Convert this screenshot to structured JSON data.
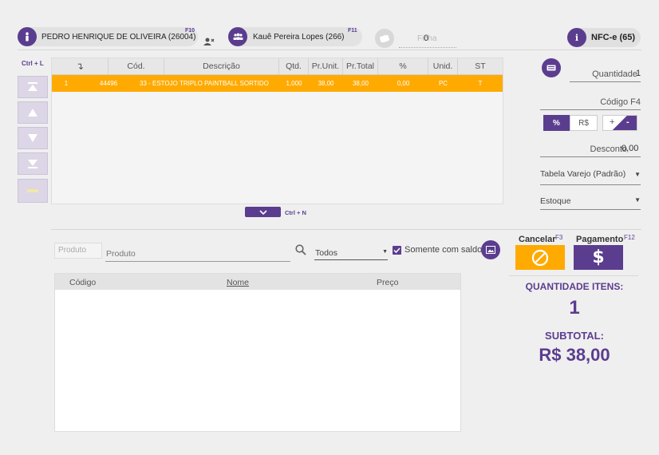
{
  "top": {
    "seller": {
      "name": "PEDRO HENRIQUE DE OLIVEIRA (26004)",
      "fkey": "F10"
    },
    "customer": {
      "name": "Kauê Pereira Lopes (266)",
      "fkey": "F11"
    },
    "ficha": {
      "placeholder": "Ficha",
      "value": "0"
    },
    "nfce": {
      "label": "NFC-e (65)"
    }
  },
  "side": {
    "shortcut_top": "Ctrl + L"
  },
  "grid": {
    "headers": [
      "Cód.",
      "Descrição",
      "Qtd.",
      "Pr.Unit.",
      "Pr.Total",
      "%",
      "Unid.",
      "ST"
    ],
    "row": {
      "n": "1",
      "cod": "44496",
      "descricao": "33 - ESTOJO TRIPLO PAINTBALL SORTIDO",
      "qtd": "1,000",
      "unit": "38,00",
      "total": "38,00",
      "pct": "0,00",
      "unid": "PC",
      "st": "T"
    },
    "expand_shortcut": "Ctrl + N"
  },
  "right": {
    "quantidade_label": "Quantidade",
    "quantidade_value": "1",
    "codigo_label": "Código F4",
    "pct_label": "%",
    "rs_label": "R$",
    "plus_label": "+",
    "minus_label": "-",
    "desconto_label": "Desconto",
    "desconto_value": "0,00",
    "tabela": "Tabela Varejo (Padrão)",
    "estoque": "Estoque"
  },
  "search": {
    "produto_small": "Produto",
    "produto_placeholder": "Produto",
    "filter": "Todos",
    "somente_label": "Somente com saldo",
    "results_headers": {
      "codigo": "Código",
      "nome": "Nome",
      "preco": "Preço"
    }
  },
  "actions": {
    "cancelar_label": "Cancelar",
    "cancelar_fkey": "F3",
    "pagamento_label": "Pagamento",
    "pagamento_fkey": "F12"
  },
  "summary": {
    "qtd_label": "QUANTIDADE ITENS:",
    "qtd_value": "1",
    "subtotal_label": "SUBTOTAL:",
    "subtotal_value": "R$ 38,00"
  },
  "colors": {
    "purple": "#5b3d8f",
    "orange": "#ffaa00"
  }
}
